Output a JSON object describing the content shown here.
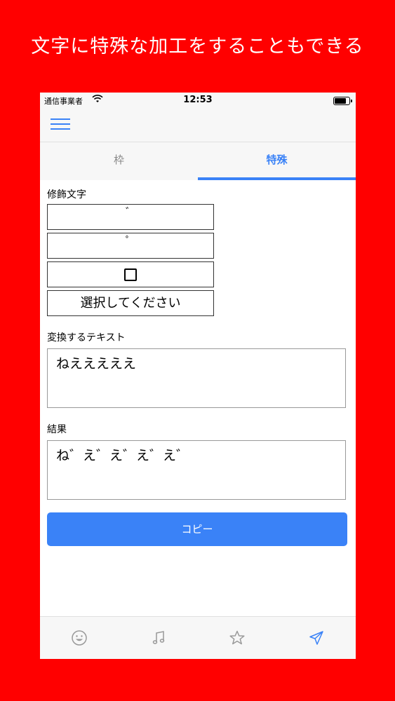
{
  "headline": "文字に特殊な加工をすることもできる",
  "status_bar": {
    "carrier": "通信事業者",
    "time": "12:53"
  },
  "tabs": [
    {
      "label": "枠",
      "active": false
    },
    {
      "label": "特殊",
      "active": true
    }
  ],
  "decoration": {
    "label": "修飾文字",
    "options": [
      "゛",
      "゜",
      "□",
      "選択してください"
    ]
  },
  "input": {
    "label": "変換するテキスト",
    "value": "ねえええええ"
  },
  "result": {
    "label": "結果",
    "value": "ね゛え゛え゛え゛え゛"
  },
  "copy_button": "コピー",
  "tab_bar": [
    "smile-icon",
    "music-note-icon",
    "star-icon",
    "paper-plane-icon"
  ],
  "colors": {
    "accent": "#3a82f7",
    "background": "#ff0000"
  }
}
